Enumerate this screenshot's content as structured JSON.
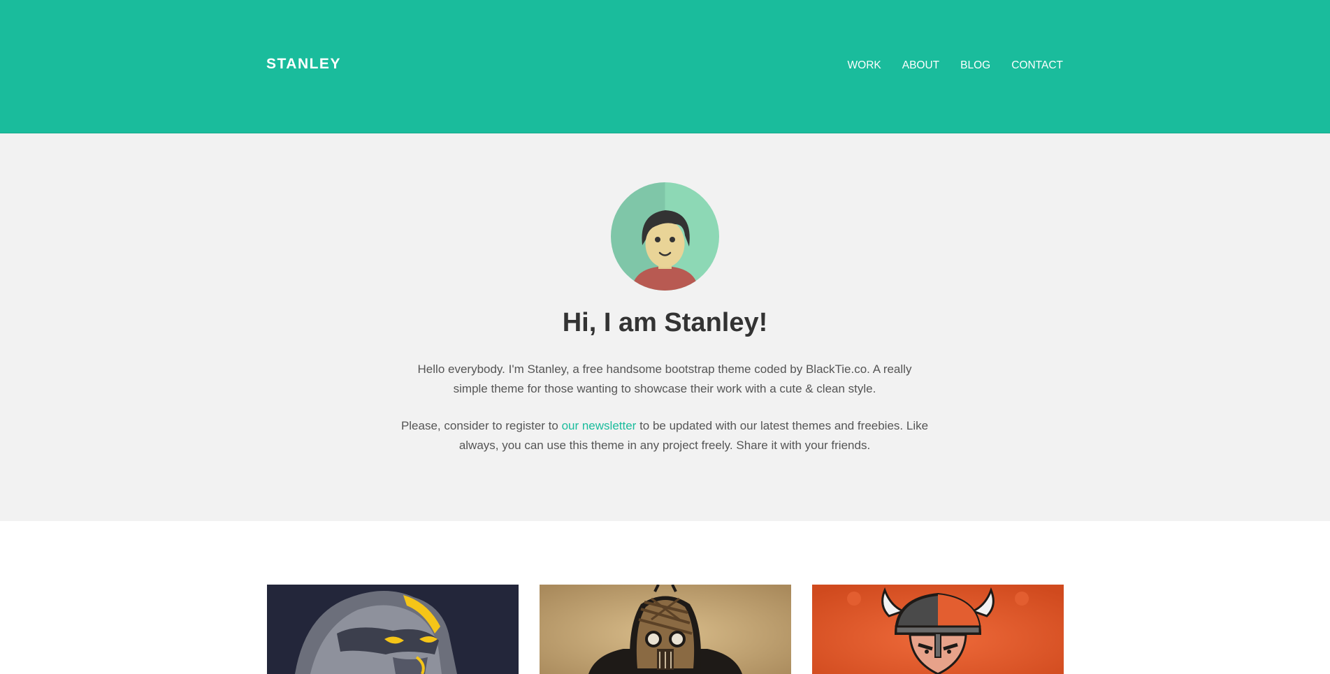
{
  "brand": "STANLEY",
  "nav": {
    "work": "WORK",
    "about": "ABOUT",
    "blog": "BLOG",
    "contact": "CONTACT"
  },
  "hero": {
    "heading": "Hi, I am Stanley!",
    "intro": "Hello everybody. I'm Stanley, a free handsome bootstrap theme coded by BlackTie.co. A really simple theme for those wanting to showcase their work with a cute & clean style.",
    "newsletter_before": "Please, consider to register to ",
    "newsletter_link": "our newsletter",
    "newsletter_after": " to be updated with our latest themes and freebies. Like always, you can use this theme in any project freely. Share it with your friends."
  },
  "portfolio": {
    "items": [
      {
        "icon": "gorilla-mascot-icon"
      },
      {
        "icon": "masked-warrior-mascot-icon"
      },
      {
        "icon": "viking-mascot-icon"
      }
    ]
  },
  "colors": {
    "accent": "#1abc9c",
    "hero_bg": "#f2f2f2",
    "heading": "#333333"
  }
}
